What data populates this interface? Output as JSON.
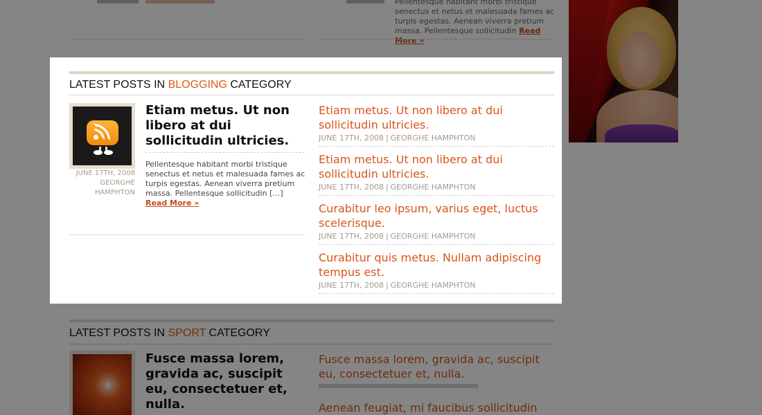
{
  "background": {
    "top_right_excerpt": "Pellentesque habitant morbi tristique senectus et netus et malesuada fames ac turpis egestas. Aenean viverra pretium massa. Pellentesque sollicitudin",
    "top_right_more": "Read More »",
    "sport_section": {
      "title_prefix": "Latest posts in ",
      "category": "Sport",
      "title_suffix": " category",
      "lead_title": "Fusce massa lorem, gravida ac, suscipit eu, consectetuer et, nulla.",
      "right_posts": [
        "Fusce massa lorem, gravida ac, suscipit eu, consectetuer et, nulla.",
        "Aenean feugiat, mi faucibus sollicitudin"
      ]
    }
  },
  "blogging_section": {
    "title_prefix": "Latest posts in ",
    "category": "Blogging",
    "title_suffix": " category",
    "featured": {
      "title": "Etiam metus. Ut non libero at dui sollicitudin ultricies.",
      "date": "June 17th, 2008",
      "author": "Georghe Hamphton",
      "excerpt": "Pellentesque habitant morbi tristique senectus et netus et malesuada fames ac turpis egestas. Aenean viverra pretium massa. Pellentesque sollicitudin […]",
      "read_more": "Read More »",
      "icon": "rss-icon"
    },
    "posts": [
      {
        "title": "Etiam metus. Ut non libero at dui sollicitudin ultricies.",
        "date": "June 17th, 2008",
        "separator": "|",
        "author": "Georghe Hamphton"
      },
      {
        "title": "Etiam metus. Ut non libero at dui sollicitudin ultricies.",
        "date": "June 17th, 2008",
        "separator": "|",
        "author": "Georghe Hamphton"
      },
      {
        "title": "Curabitur leo ipsum, varius eget, luctus scelerisque.",
        "date": "June 17th, 2008",
        "separator": "|",
        "author": "Georghe Hamphton"
      },
      {
        "title": "Curabitur quis metus. Nullam adipiscing tempus est.",
        "date": "June 17th, 2008",
        "separator": "|",
        "author": "Georghe Hamphton"
      }
    ]
  },
  "colors": {
    "accent": "#e05a12",
    "link": "#d9541b",
    "meta": "#a39a8d",
    "overlay": "rgba(0,0,0,0.48)"
  }
}
